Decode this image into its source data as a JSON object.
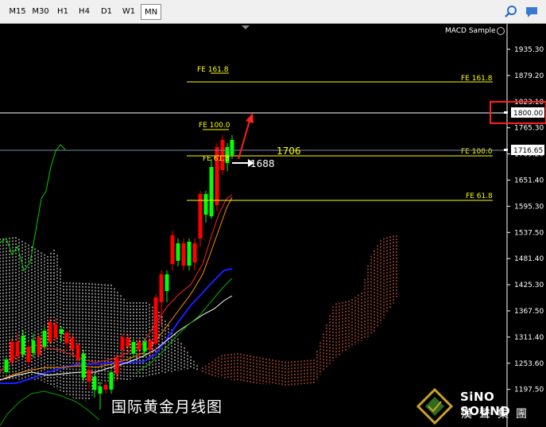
{
  "toolbar": {
    "timeframes": [
      "M15",
      "M30",
      "H1",
      "H4",
      "D1",
      "W1",
      "MN"
    ],
    "active": "MN"
  },
  "indicator": {
    "label": "MACD Sample"
  },
  "price_axis": {
    "ticks": [
      "1935.30",
      "1879.20",
      "1823.10",
      "1765.30",
      "1709.20",
      "1651.40",
      "1595.30",
      "1537.50",
      "1481.40",
      "1425.30",
      "1367.50",
      "1311.40",
      "1253.60",
      "1197.50"
    ],
    "current_price": "1716.65",
    "level_marker": "1800.00"
  },
  "annotations": {
    "fe_161_left": "FE 161.8",
    "fe_161_right": "FE 161.8",
    "fe_100_left": "FE 100.0",
    "fe_100_right": "FE 100.0",
    "fe_61_left": "FE 61.8",
    "fe_61_right": "FE 61.8",
    "price_1706": "1706",
    "price_1688": "1688"
  },
  "caption": "国际黄金月线图",
  "brand": {
    "en": "SiNO SOUND",
    "cn": "漢聲集團"
  },
  "colors": {
    "bull": "#00ff00",
    "bear": "#ff0000",
    "fe_line": "#ffff00",
    "cloud_a": "#ffffff",
    "cloud_b": "#ff6a4d",
    "marker_box": "#ff0000"
  }
}
